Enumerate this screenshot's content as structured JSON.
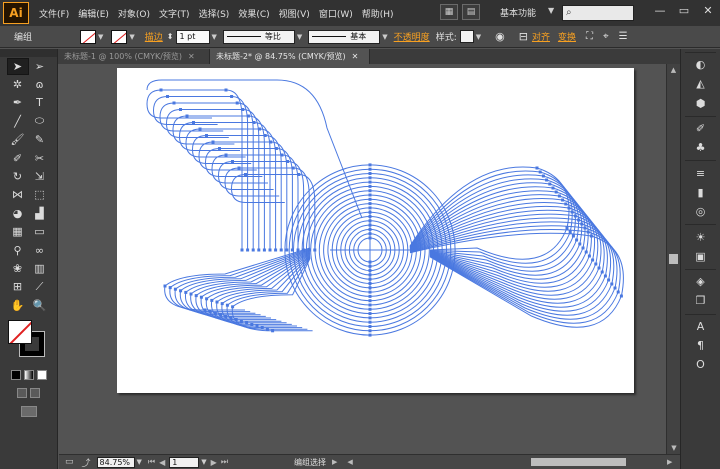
{
  "app": {
    "logo": "Ai",
    "menu": [
      "文件(F)",
      "编辑(E)",
      "对象(O)",
      "文字(T)",
      "选择(S)",
      "效果(C)",
      "视图(V)",
      "窗口(W)",
      "帮助(H)"
    ],
    "workspace_label": "基本功能",
    "window_controls": [
      "—",
      "▭",
      "✕"
    ]
  },
  "control_bar": {
    "selection_label": "编组",
    "stroke_link": "描边",
    "stroke_weight": "1 pt",
    "profile_label": "等比",
    "brush_label": "基本",
    "opacity_link": "不透明度",
    "style_label": "样式:",
    "align_link": "对齐",
    "transform_link": "变换"
  },
  "tabs": [
    {
      "label": "未标题-1 @ 100% (CMYK/预览)",
      "active": false
    },
    {
      "label": "未标题-2* @ 84.75% (CMYK/预览)",
      "active": true
    }
  ],
  "tools": [
    [
      "selection-tool",
      "direct-selection-tool"
    ],
    [
      "magic-wand-tool",
      "lasso-tool"
    ],
    [
      "pen-tool",
      "type-tool"
    ],
    [
      "line-segment-tool",
      "ellipse-tool"
    ],
    [
      "paintbrush-tool",
      "pencil-tool"
    ],
    [
      "blob-brush-tool",
      "scissors-tool"
    ],
    [
      "rotate-tool",
      "scale-tool"
    ],
    [
      "width-tool",
      "free-transform-tool"
    ],
    [
      "shape-builder-tool",
      "perspective-grid-tool"
    ],
    [
      "mesh-tool",
      "gradient-tool"
    ],
    [
      "eyedropper-tool",
      "blend-tool"
    ],
    [
      "symbol-sprayer-tool",
      "column-graph-tool"
    ],
    [
      "artboard-tool",
      "slice-tool"
    ],
    [
      "hand-tool",
      "zoom-tool"
    ]
  ],
  "dock_icons": [
    "color-icon",
    "color-guide-icon",
    "swatches-icon",
    "brushes-icon",
    "symbols-icon",
    "stroke-icon",
    "gradient-icon",
    "transparency-icon",
    "appearance-icon",
    "graphic-styles-icon",
    "layers-icon",
    "artboards-icon",
    "asset-export-icon"
  ],
  "status_bar": {
    "zoom": "84.75%",
    "artboard_number": "1",
    "status_text": "编组选择"
  },
  "colors": {
    "accent": "#f7a021",
    "path_blue": "#4a78e0",
    "panel_dark": "#323232",
    "canvas_bg": "#535353"
  }
}
